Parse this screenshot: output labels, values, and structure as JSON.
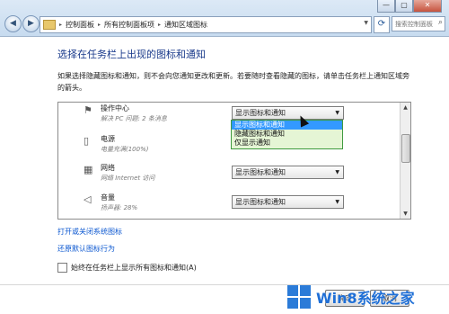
{
  "window": {
    "minimize_glyph": "—",
    "maximize_glyph": "▢",
    "close_glyph": "✕"
  },
  "nav": {
    "back_glyph": "◀",
    "forward_glyph": "▶"
  },
  "breadcrumb": [
    "控制面板",
    "所有控制面板项",
    "通知区域图标"
  ],
  "address_separator": "▸",
  "search": {
    "placeholder": "搜索控制面板"
  },
  "main": {
    "title": "选择在任务栏上出现的图标和通知",
    "description": "如果选择隐藏图标和通知，则不会向您通知更改和更新。若要随时查看隐藏的图标，请单击任务栏上通知区域旁的箭头。"
  },
  "icons": {
    "rows": [
      {
        "name": "操作中心",
        "desc": "解决 PC 问题: 2 条消息",
        "behavior": "显示图标和通知",
        "icon": "flag-icon"
      },
      {
        "name": "电源",
        "desc": "电量充满(100%)",
        "behavior": "",
        "icon": "power-icon"
      },
      {
        "name": "网络",
        "desc": "网络 Internet 访问",
        "behavior": "显示图标和通知",
        "icon": "network-icon"
      },
      {
        "name": "音量",
        "desc": "扬声器: 28%",
        "behavior": "显示图标和通知",
        "icon": "volume-icon"
      }
    ]
  },
  "dropdown_options": [
    "显示图标和通知",
    "隐藏图标和通知",
    "仅显示通知"
  ],
  "links": {
    "system_icons": "打开或关闭系统图标",
    "restore_defaults": "还原默认图标行为"
  },
  "checkbox": {
    "label": "始终在任务栏上显示所有图标和通知(A)",
    "checked": false
  },
  "buttons": {
    "ok": "确定",
    "cancel": "取消"
  },
  "watermark": "Win8系统之家",
  "colors": {
    "accent_link": "#0b57d0",
    "title": "#1a3a8b",
    "dropdown_highlight": "#3399ff",
    "dropdown_bg": "#e5f5d5"
  }
}
